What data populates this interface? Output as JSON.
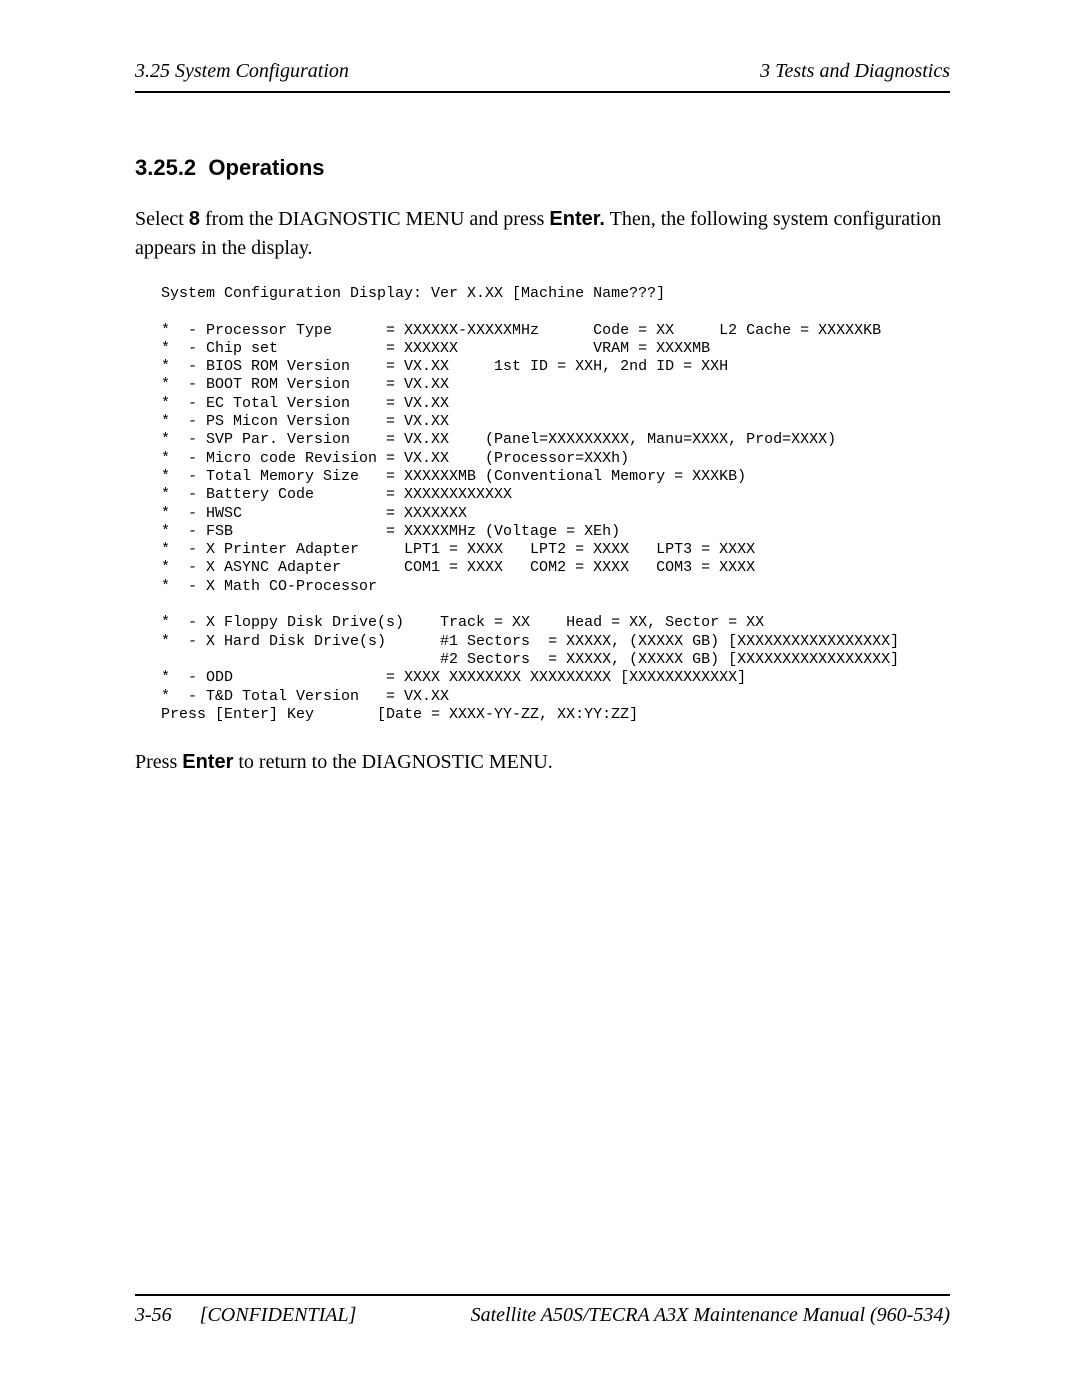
{
  "header": {
    "left": "3.25 System Configuration",
    "right": "3 Tests and Diagnostics"
  },
  "section": {
    "number": "3.25.2",
    "title": "Operations"
  },
  "intro": {
    "pre": "Select ",
    "key1": "8",
    "mid": " from the DIAGNOSTIC MENU and press ",
    "key2": "Enter.",
    "post": " Then, the following system configuration appears in the display."
  },
  "code": "System Configuration Display: Ver X.XX [Machine Name???]\n\n*  - Processor Type      = XXXXXX-XXXXXMHz      Code = XX     L2 Cache = XXXXXKB\n*  - Chip set            = XXXXXX               VRAM = XXXXMB\n*  - BIOS ROM Version    = VX.XX     1st ID = XXH, 2nd ID = XXH\n*  - BOOT ROM Version    = VX.XX\n*  - EC Total Version    = VX.XX\n*  - PS Micon Version    = VX.XX\n*  - SVP Par. Version    = VX.XX    (Panel=XXXXXXXXX, Manu=XXXX, Prod=XXXX)\n*  - Micro code Revision = VX.XX    (Processor=XXXh)\n*  - Total Memory Size   = XXXXXXMB (Conventional Memory = XXXKB)\n*  - Battery Code        = XXXXXXXXXXXX\n*  - HWSC                = XXXXXXX\n*  - FSB                 = XXXXXMHz (Voltage = XEh)\n*  - X Printer Adapter     LPT1 = XXXX   LPT2 = XXXX   LPT3 = XXXX\n*  - X ASYNC Adapter       COM1 = XXXX   COM2 = XXXX   COM3 = XXXX\n*  - X Math CO-Processor\n\n*  - X Floppy Disk Drive(s)    Track = XX    Head = XX, Sector = XX\n*  - X Hard Disk Drive(s)      #1 Sectors  = XXXXX, (XXXXX GB) [XXXXXXXXXXXXXXXXX]\n                               #2 Sectors  = XXXXX, (XXXXX GB) [XXXXXXXXXXXXXXXXX]\n*  - ODD                 = XXXX XXXXXXXX XXXXXXXXX [XXXXXXXXXXXX]\n*  - T&D Total Version   = VX.XX\nPress [Enter] Key       [Date = XXXX-YY-ZZ, XX:YY:ZZ]",
  "outro": {
    "pre": "Press ",
    "key": "Enter",
    "post": " to return to the DIAGNOSTIC MENU."
  },
  "footer": {
    "page": "3-56",
    "confidential": "[CONFIDENTIAL]",
    "right": "Satellite A50S/TECRA A3X  Maintenance Manual (960-534)"
  }
}
